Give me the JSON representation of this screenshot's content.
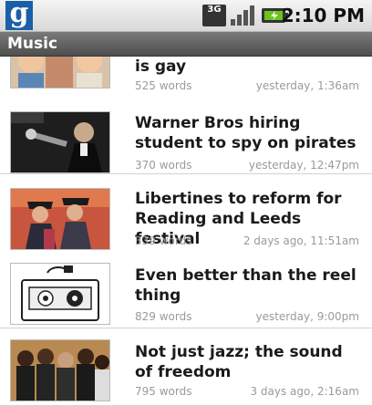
{
  "status": {
    "network": "3G",
    "time": "2:10 PM"
  },
  "titlebar": {
    "title": "Music"
  },
  "articles": [
    {
      "headline": "is gay",
      "words": "525 words",
      "when": "yesterday, 1:36am",
      "image": "babies-photo"
    },
    {
      "headline": "Warner Bros hiring student to spy on pirates",
      "words": "370 words",
      "when": "yesterday, 12:47pm",
      "image": "spy-with-gun-photo"
    },
    {
      "headline": "Libertines to reform for Reading and Leeds festival",
      "words": "339 words",
      "when": "2 days ago, 11:51am",
      "image": "band-members-photo"
    },
    {
      "headline": "Even better than the reel thing",
      "words": "829 words",
      "when": "yesterday, 9:00pm",
      "image": "cassette-tape-illustration"
    },
    {
      "headline": "Not just jazz; the sound of freedom",
      "words": "795 words",
      "when": "3 days ago, 2:16am",
      "image": "jazz-band-photo"
    }
  ],
  "colors": {
    "titlebar": "#5a5a5a",
    "headline": "#1a1a1a",
    "meta": "#9a9a9a"
  }
}
